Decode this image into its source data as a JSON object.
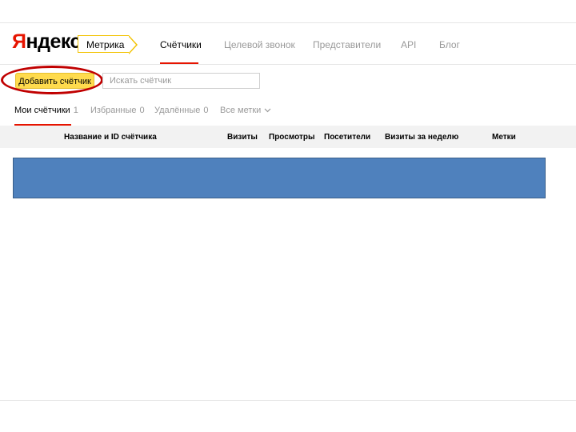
{
  "logo": {
    "first_letter": "Я",
    "rest": "ндекс"
  },
  "product_tag": "Метрика",
  "top_nav": [
    {
      "label": "Счётчики",
      "active": true
    },
    {
      "label": "Целевой звонок",
      "active": false
    },
    {
      "label": "Представители",
      "active": false
    },
    {
      "label": "API",
      "active": false
    },
    {
      "label": "Блог",
      "active": false
    }
  ],
  "actions": {
    "add_counter_label": "Добавить счётчик",
    "search_placeholder": "Искать счётчик"
  },
  "tabs": [
    {
      "label": "Мои счётчики",
      "count": "1",
      "active": true
    },
    {
      "label": "Избранные",
      "count": "0",
      "active": false
    },
    {
      "label": "Удалённые",
      "count": "0",
      "active": false
    },
    {
      "label": "Все метки",
      "count": "",
      "active": false,
      "dropdown": true
    }
  ],
  "table": {
    "columns": [
      "Название и ID счётчика",
      "Визиты",
      "Просмотры",
      "Посетители",
      "Визиты за неделю",
      "Метки"
    ]
  },
  "colors": {
    "brand_red": "#e61400",
    "button_yellow": "#ffdb4d",
    "highlight_circle": "#c00000",
    "placeholder_block": "#4f81bd"
  },
  "icons": {
    "dropdown": "chevron-down-icon"
  }
}
